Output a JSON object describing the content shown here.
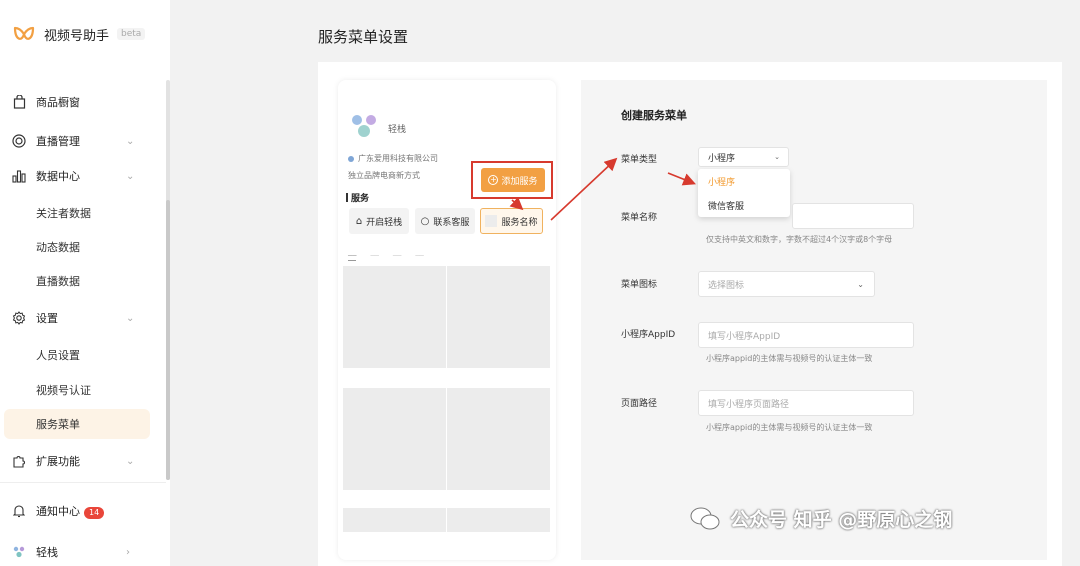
{
  "app": {
    "name": "视频号助手",
    "beta": "beta"
  },
  "sidebar": {
    "items": [
      {
        "label": "商品橱窗"
      },
      {
        "label": "直播管理"
      },
      {
        "label": "数据中心"
      },
      {
        "label": "关注者数据"
      },
      {
        "label": "动态数据"
      },
      {
        "label": "直播数据"
      },
      {
        "label": "设置"
      },
      {
        "label": "人员设置"
      },
      {
        "label": "视频号认证"
      },
      {
        "label": "服务菜单"
      },
      {
        "label": "扩展功能"
      },
      {
        "label": "通知中心",
        "badge": "14"
      },
      {
        "label": "轻栈"
      }
    ]
  },
  "page": {
    "title": "服务菜单设置"
  },
  "preview": {
    "shop_name": "轻栈",
    "company": "广东爱用科技有限公司",
    "tagline": "独立品牌电商新方式",
    "services_title": "服务",
    "buttons": [
      "开启轻栈",
      "联系客服",
      "服务名称"
    ],
    "add_button": "添加服务"
  },
  "config": {
    "title": "创建服务菜单",
    "menu_type_label": "菜单类型",
    "menu_type_value": "小程序",
    "menu_type_options": [
      "小程序",
      "微信客服"
    ],
    "menu_name_label": "菜单名称",
    "menu_name_hint": "仅支持中英文和数字，字数不超过4个汉字或8个字母",
    "menu_icon_label": "菜单图标",
    "menu_icon_placeholder": "选择图标",
    "appid_label": "小程序AppID",
    "appid_placeholder": "填写小程序AppID",
    "appid_hint": "小程序appid的主体需与视频号的认证主体一致",
    "path_label": "页面路径",
    "path_placeholder": "填写小程序页面路径",
    "path_hint": "小程序appid的主体需与视频号的认证主体一致"
  },
  "watermark": {
    "text": "公众号 知乎 @野原心之钢"
  },
  "colors": {
    "accent": "#f2a043",
    "active_bg": "#fdf3e6",
    "annotation_red": "#d73a2e",
    "badge_red": "#e9463a"
  }
}
